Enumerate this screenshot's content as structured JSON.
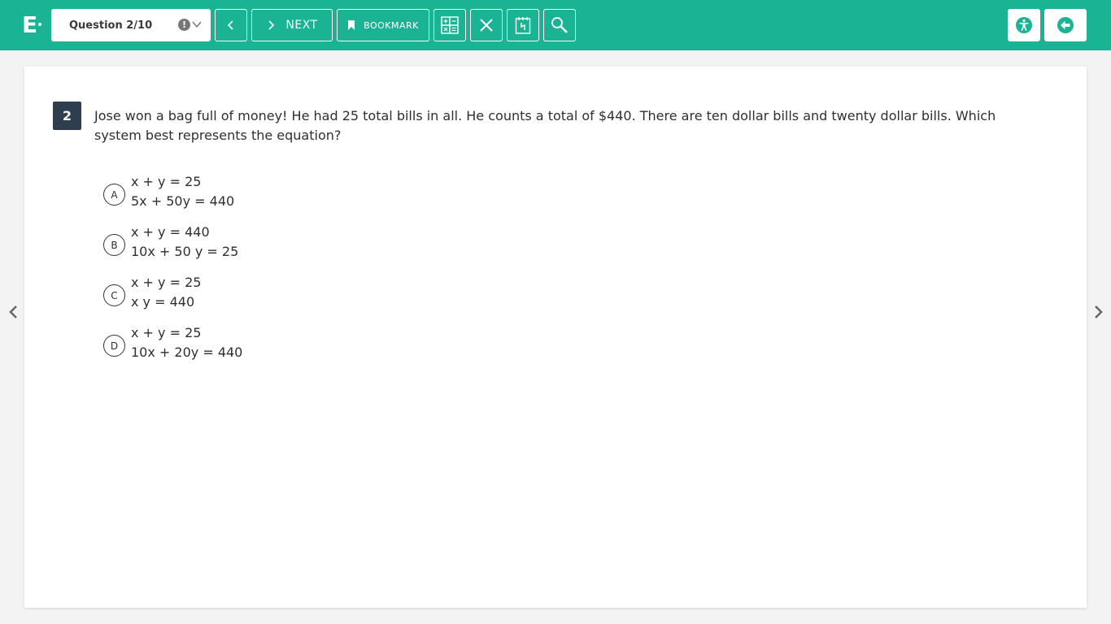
{
  "app": {
    "logo_text": "E",
    "brand_color": "#1ab394",
    "dark_color": "#2f3e4e"
  },
  "toolbar": {
    "question_select": "Question 2/10",
    "warning_glyph": "!",
    "next_label": "NEXT",
    "bookmark_label": "BOOKMARK",
    "icons": [
      "chevron-left-icon",
      "chevron-right-icon",
      "bookmark-icon",
      "calculator-icon",
      "close-icon",
      "notepad-icon",
      "search-icon",
      "accessibility-icon",
      "exit-icon"
    ]
  },
  "question": {
    "number": "2",
    "text": "Jose won a bag full of money!  He had 25 total bills in all.  He counts a total of $440.  There are ten dollar bills and twenty dollar bills.  Which system best represents the equation?",
    "choices": [
      {
        "letter": "A",
        "line1": "x + y = 25",
        "line2": "5x + 50y = 440"
      },
      {
        "letter": "B",
        "line1": "x + y = 440",
        "line2": "10x + 50 y = 25"
      },
      {
        "letter": "C",
        "line1": "x + y = 25",
        "line2": "x y = 440"
      },
      {
        "letter": "D",
        "line1": "x + y = 25",
        "line2": "10x + 20y = 440"
      }
    ]
  }
}
